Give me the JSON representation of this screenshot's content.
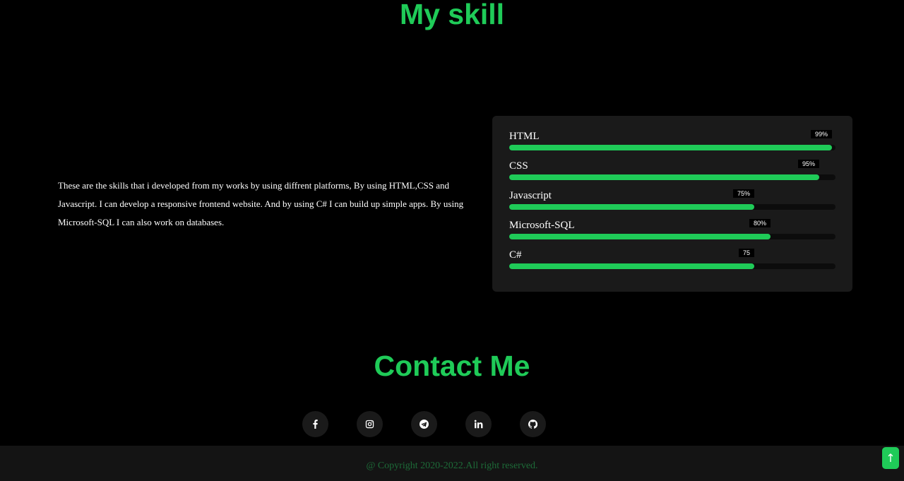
{
  "skills_section": {
    "title": "My skill",
    "description": "These are the skills that i developed from my works by using diffrent platforms, By using HTML,CSS and Javascript. I can develop a responsive frontend website. And by using C# I can build up simple apps. By using Microsoft-SQL I can also work on databases.",
    "skills": [
      {
        "name": "HTML",
        "badge": "99%",
        "level": 0.99
      },
      {
        "name": "CSS",
        "badge": "95%",
        "level": 0.95
      },
      {
        "name": "Javascript",
        "badge": "75%",
        "level": 0.75
      },
      {
        "name": "Microsoft-SQL",
        "badge": "80%",
        "level": 0.8
      },
      {
        "name": "C#",
        "badge": "75",
        "level": 0.75
      }
    ]
  },
  "contact_section": {
    "title": "Contact Me",
    "socials": [
      {
        "icon": "facebook-icon"
      },
      {
        "icon": "instagram-icon"
      },
      {
        "icon": "telegram-icon"
      },
      {
        "icon": "linkedin-icon"
      },
      {
        "icon": "github-icon"
      }
    ]
  },
  "footer": {
    "copyright": "@ Copyright 2020-2022.All right reserved."
  },
  "scroll_top": {
    "icon": "arrow-up-icon",
    "glyph": "↑"
  },
  "colors": {
    "accent": "#1fcb58",
    "background": "#000000",
    "card": "#1a1a1a",
    "footer_text": "#1d6b38"
  }
}
